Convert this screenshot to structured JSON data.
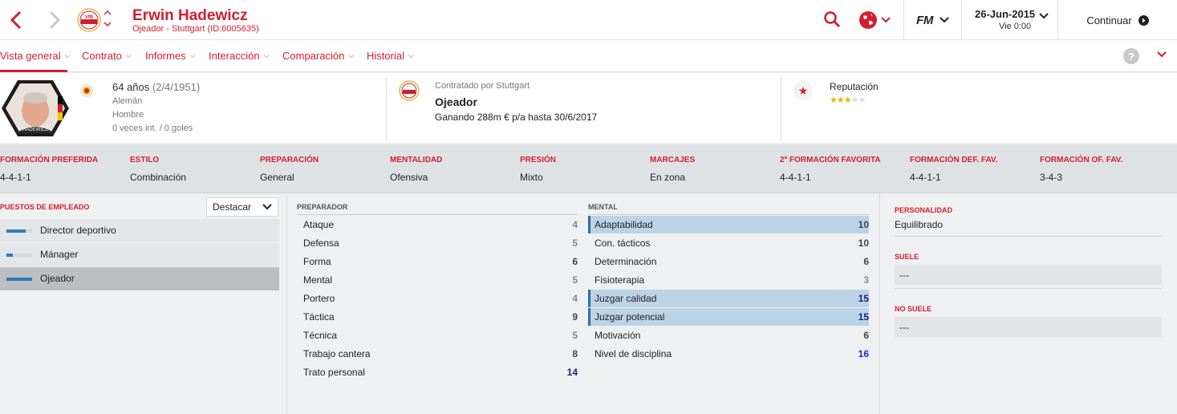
{
  "header": {
    "name": "Erwin Hadewicz",
    "subtitle": "Ojeador - Stuttgart (ID:6005635)",
    "badge_text": "VfB",
    "fm_label": "FM",
    "date": "26-Jun-2015",
    "day": "Vie 0:00",
    "continue_label": "Continuar"
  },
  "tabs": [
    {
      "label": "Vista general"
    },
    {
      "label": "Contrato"
    },
    {
      "label": "Informes"
    },
    {
      "label": "Interacción"
    },
    {
      "label": "Comparación"
    },
    {
      "label": "Historial"
    }
  ],
  "help_label": "?",
  "profile": {
    "portrait_caption": "HADEWICZ",
    "age": "64 años",
    "dob": "(2/4/1951)",
    "nationality": "Alemán",
    "gender": "Hombre",
    "caps": "0 veces int. / 0 goles"
  },
  "contract": {
    "hired_by": "Contratado por Stuttgart",
    "role": "Ojeador",
    "terms": "Ganando 288m € p/a hasta 30/6/2017"
  },
  "reputation": {
    "label": "Reputación",
    "stars_filled": 2.5,
    "stars_total": 5
  },
  "tactics": [
    {
      "label": "Formación preferida",
      "value": "4-4-1-1"
    },
    {
      "label": "Estilo",
      "value": "Combinación"
    },
    {
      "label": "Preparación",
      "value": "General"
    },
    {
      "label": "Mentalidad",
      "value": "Ofensiva"
    },
    {
      "label": "Presión",
      "value": "Mixto"
    },
    {
      "label": "Marcajes",
      "value": "En zona"
    },
    {
      "label": "2ª formación favorita",
      "value": "4-4-1-1"
    },
    {
      "label": "Formación def. fav.",
      "value": "4-4-1-1"
    },
    {
      "label": "Formación of. fav.",
      "value": "3-4-3"
    }
  ],
  "positions": {
    "title": "PUESTOS DE EMPLEADO",
    "highlight_label": "Destacar",
    "roles": [
      {
        "label": "Director deportivo",
        "level": 0.75
      },
      {
        "label": "Mánager",
        "level": 0.25
      },
      {
        "label": "Ojeador",
        "level": 1.0
      }
    ]
  },
  "coaching": {
    "title": "PREPARADOR",
    "attrs": [
      {
        "name": "Ataque",
        "value": "4"
      },
      {
        "name": "Defensa",
        "value": "5"
      },
      {
        "name": "Forma",
        "value": "6"
      },
      {
        "name": "Mental",
        "value": "5"
      },
      {
        "name": "Portero",
        "value": "4"
      },
      {
        "name": "Táctica",
        "value": "9"
      },
      {
        "name": "Técnica",
        "value": "5"
      },
      {
        "name": "Trabajo cantera",
        "value": "8"
      },
      {
        "name": "Trato personal",
        "value": "14"
      }
    ]
  },
  "mental": {
    "title": "MENTAL",
    "attrs": [
      {
        "name": "Adaptabilidad",
        "value": "10",
        "highlight": true
      },
      {
        "name": "Con. tácticos",
        "value": "10",
        "highlight": false
      },
      {
        "name": "Determinación",
        "value": "6",
        "highlight": false
      },
      {
        "name": "Fisioterapia",
        "value": "3",
        "highlight": false
      },
      {
        "name": "Juzgar calidad",
        "value": "15",
        "highlight": true
      },
      {
        "name": "Juzgar potencial",
        "value": "15",
        "highlight": true
      },
      {
        "name": "Motivación",
        "value": "6",
        "highlight": false
      },
      {
        "name": "Nivel de disciplina",
        "value": "16",
        "highlight": false
      }
    ]
  },
  "personality": {
    "label": "PERSONALIDAD",
    "value": "Equilibrado",
    "usually_label": "SUELE",
    "usually_value": "---",
    "never_label": "NO SUELE",
    "never_value": "---"
  },
  "colors": {
    "accent": "#d11f2e",
    "highlight_row": "#bcd3e6",
    "role_bar": "#2b7dc0",
    "star": "#e6b400"
  }
}
